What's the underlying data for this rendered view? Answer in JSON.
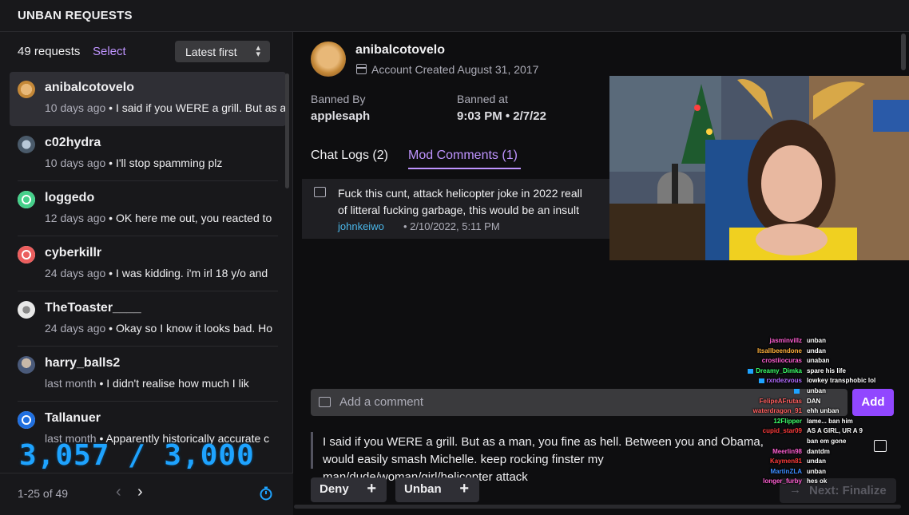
{
  "header": {
    "title": "UNBAN REQUESTS"
  },
  "list": {
    "count_label": "49 requests",
    "select_label": "Select",
    "sort_label": "Latest first",
    "items": [
      {
        "username": "anibalcotovelo",
        "age": "10 days ago",
        "preview": "I said if you WERE a grill. But as a man",
        "avatar_color": "#c48838"
      },
      {
        "username": "c02hydra",
        "age": "10 days ago",
        "preview": "I'll stop spamming plz",
        "avatar_color": "#6a7b8c"
      },
      {
        "username": "loggedo",
        "age": "12 days ago",
        "preview": "OK here me out, you reacted to",
        "avatar_color": "#45d08a"
      },
      {
        "username": "cyberkillr",
        "age": "24 days ago",
        "preview": "I was kidding. i'm irl 18 y/o and",
        "avatar_color": "#eb5e5e"
      },
      {
        "username": "TheToaster____",
        "age": "24 days ago",
        "preview": "Okay so I know it looks bad. Ho",
        "avatar_color": "#d8d8d8"
      },
      {
        "username": "harry_balls2",
        "age": "last month",
        "preview": "I didn't realise how much I lik",
        "avatar_color": "#8a8a9a"
      },
      {
        "username": "Tallanuer",
        "age": "last month",
        "preview": "Apparently historically accurate c",
        "avatar_color": "#1f6fe0"
      }
    ],
    "overlay_counter": "3,057 / 3,000",
    "pagination": "1-25 of 49"
  },
  "detail": {
    "username": "anibalcotovelo",
    "account_created": "Account Created August 31, 2017",
    "banned_by_label": "Banned By",
    "banned_by": "applesaph",
    "banned_at_label": "Banned at",
    "banned_at": "9:03 PM • 2/7/22",
    "tabs": {
      "chat_logs": "Chat Logs (2)",
      "mod_comments": "Mod Comments (1)"
    },
    "comment": {
      "text_line1": "Fuck this cunt, attack helicopter joke in 2022 reall",
      "text_line2": "of litteral fucking garbage, this would be an insult",
      "author": "johnkeiwo",
      "date": "•  2/10/2022, 5:11 PM"
    },
    "add_comment_placeholder": "Add a comment",
    "add_button": "Add",
    "request_text": "I said if you WERE a grill. But as a man, you fine as hell. Between you and Obama, would easily smash Michelle. keep rocking finster my man/dude/woman/girl/helicopter attack",
    "deny_label": "Deny",
    "unban_label": "Unban",
    "next_label": "Next: Finalize"
  },
  "chat_overlay": [
    {
      "name": "jasminvillz",
      "msg": "unban",
      "color": "#ff5fd2"
    },
    {
      "name": "Itsallbeendone",
      "msg": "undan",
      "color": "#ffb13b"
    },
    {
      "name": "crostiiocuras",
      "msg": "unaban",
      "color": "#ff5fd2"
    },
    {
      "name": "Dreamy_Dimka",
      "msg": "spare his life",
      "color": "#3cff6a",
      "badge": true
    },
    {
      "name": "rxndezvous",
      "msg": "lowkey transphobic lol",
      "color": "#b26bff",
      "badge": true
    },
    {
      "name": "",
      "msg": "unban",
      "color": "#ff3b3b",
      "badge": true
    },
    {
      "name": "FelipeAFrutas",
      "msg": "DAN",
      "color": "#ff5f5f"
    },
    {
      "name": "waterdragon_91",
      "msg": "ehh unban",
      "color": "#ff5f5f"
    },
    {
      "name": "12Flipper",
      "msg": "lame... ban him",
      "color": "#3cff6a"
    },
    {
      "name": "cupid_star09",
      "msg": "AS A GIRL, UR A 9",
      "color": "#ff3b3b"
    },
    {
      "name": "",
      "msg": "ban em gone",
      "color": "#ff5fd2"
    },
    {
      "name": "Meerlin98",
      "msg": "dantdm",
      "color": "#ff5fd2"
    },
    {
      "name": "Kaymen81",
      "msg": "undan",
      "color": "#ff3b3b"
    },
    {
      "name": "MartinZLA",
      "msg": "unban",
      "color": "#3c8cff"
    },
    {
      "name": "longer_furby",
      "msg": "hes ok",
      "color": "#ff5fd2"
    }
  ]
}
